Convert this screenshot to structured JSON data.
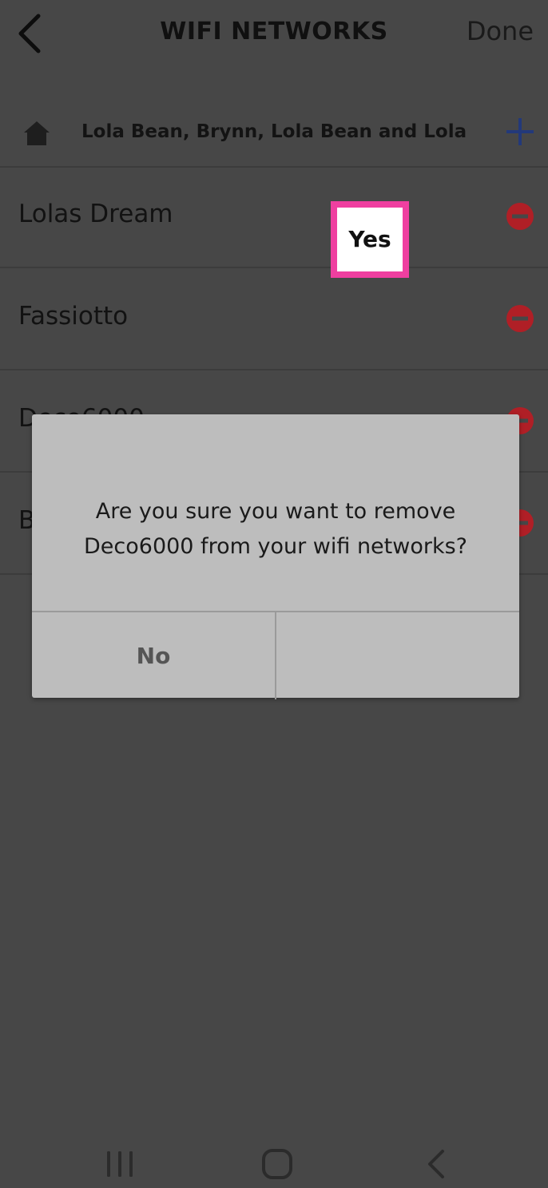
{
  "header": {
    "title": "WIFI NETWORKS",
    "done_label": "Done"
  },
  "home": {
    "label": "Lola Bean, Brynn, Lola Bean and Lola"
  },
  "networks": [
    {
      "name": "Lolas Dream"
    },
    {
      "name": "Fassiotto"
    },
    {
      "name": "Deco6000"
    },
    {
      "name": "B"
    }
  ],
  "dialog": {
    "message_line1": "Are you sure you want to remove",
    "message_line2": "Deco6000 from your wifi networks?",
    "no_label": "No",
    "yes_label": "Yes"
  },
  "colors": {
    "background": "#474747",
    "remove_red": "#b01f26",
    "add_blue": "#23397a",
    "highlight_pink": "#ef3fa0"
  },
  "icons": {
    "back": "chevron-left-icon",
    "home": "home-icon",
    "add": "plus-icon",
    "remove": "minus-circle-icon"
  }
}
